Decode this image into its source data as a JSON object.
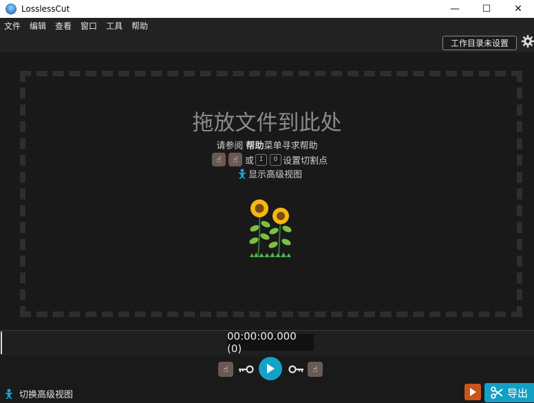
{
  "window": {
    "title": "LosslessCut",
    "controls": {
      "minimize": "—",
      "maximize": "☐",
      "close": "✕"
    }
  },
  "menu": {
    "items": [
      {
        "label": "文件"
      },
      {
        "label": "编辑"
      },
      {
        "label": "查看"
      },
      {
        "label": "窗口"
      },
      {
        "label": "工具"
      },
      {
        "label": "帮助"
      }
    ]
  },
  "topbar": {
    "workdir_button": "工作目录未设置",
    "settings_icon": "gear-icon"
  },
  "dropzone": {
    "title": "拖放文件到此处",
    "help_prefix": "请参阅 ",
    "help_bold": "帮助",
    "help_suffix": "菜单寻求帮助",
    "or_text": "或",
    "key_in": "I",
    "key_out": "O",
    "cutpoint_text": "设置切割点",
    "show_advanced": "显示高级视图"
  },
  "timeline": {
    "timecode": "00:00:00.000 (0)"
  },
  "bottom": {
    "toggle_advanced": "切换高级视图",
    "export_label": "导出"
  },
  "colors": {
    "accent": "#14a3c8",
    "export_bg": "#12a0c4",
    "orange": "#c8541a",
    "hand_bg": "#6b5a52",
    "background": "#1a1a1a"
  }
}
